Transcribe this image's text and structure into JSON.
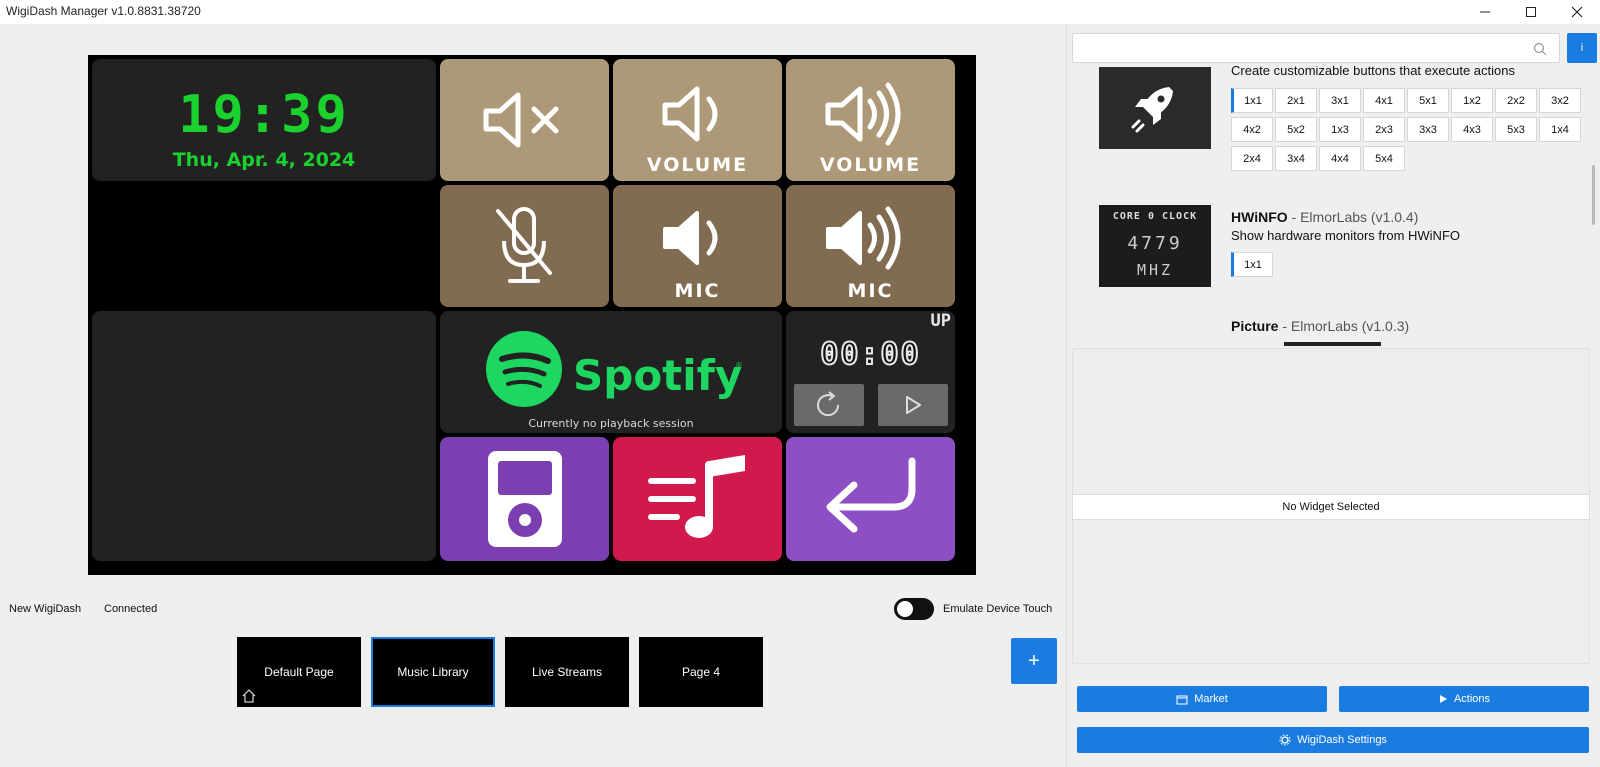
{
  "window": {
    "title": "WigiDash Manager v1.0.8831.38720",
    "controls": [
      "minimize-icon",
      "maximize-icon",
      "close-icon"
    ]
  },
  "device": {
    "clock": {
      "time": "19:39",
      "date": "Thu, Apr. 4, 2024"
    },
    "tiles": {
      "volume_down_label": "VOLUME",
      "volume_up_label": "VOLUME",
      "mic_down_label": "MIC",
      "mic_up_label": "MIC"
    },
    "spotify": {
      "name": "Spotify",
      "status": "Currently no playback session"
    },
    "timer": {
      "mode": "UP",
      "time": "00:00"
    },
    "colors": {
      "clock_green": "#1ad12e",
      "spotify_green": "#1ed760",
      "tan": "#ad9977",
      "brown": "#816c51",
      "purple": "#7c3fb2",
      "pink": "#d01a4d"
    }
  },
  "status": {
    "device_name": "New WigiDash",
    "connection": "Connected",
    "emulate_touch_label": "Emulate Device Touch",
    "emulate_touch_on": false
  },
  "pages": [
    {
      "label": "Default Page",
      "active": false,
      "home": true
    },
    {
      "label": "Music Library",
      "active": true,
      "home": false
    },
    {
      "label": "Live Streams",
      "active": false,
      "home": false
    },
    {
      "label": "Page 4",
      "active": false,
      "home": false
    }
  ],
  "add_page_label": "+",
  "sidebar": {
    "search": {
      "value": "",
      "placeholder": ""
    },
    "info_label": "i",
    "widgets": [
      {
        "name": "",
        "author": "",
        "version": "",
        "description": "Create customizable buttons that execute actions",
        "icon": "rocket-icon",
        "sizes": [
          "1x1",
          "2x1",
          "3x1",
          "4x1",
          "5x1",
          "1x2",
          "2x2",
          "3x2",
          "4x2",
          "5x2",
          "1x3",
          "2x3",
          "3x3",
          "4x3",
          "5x3",
          "1x4",
          "2x4",
          "3x4",
          "4x4",
          "5x4"
        ],
        "selected_size": "1x1"
      },
      {
        "name": "HWiNFO",
        "author": " - ElmorLabs",
        "version": "(v1.0.4)",
        "description": "Show hardware monitors from HWiNFO",
        "thumb_lines": [
          "CORE 0 CLOCK",
          "4779",
          "MHZ"
        ],
        "sizes": [
          "1x1"
        ],
        "selected_size": "1x1"
      },
      {
        "name": "Picture",
        "author": " - ElmorLabs",
        "version": "(v1.0.3)"
      }
    ],
    "no_widget_text": "No Widget Selected",
    "buttons": {
      "market": "Market",
      "actions": "Actions",
      "settings": "WigiDash Settings"
    }
  }
}
